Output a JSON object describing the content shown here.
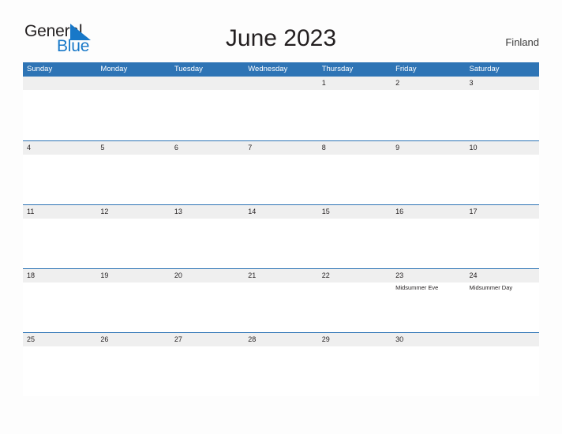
{
  "brand": {
    "name_part1": "General",
    "name_part2": "Blue",
    "flag_icon": "blue-triangle-flag-icon",
    "color_primary": "#1878c8",
    "color_text": "#231f20"
  },
  "header": {
    "title": "June 2023",
    "country": "Finland"
  },
  "calendar": {
    "accent_color": "#2e74b5",
    "band_color": "#efefef",
    "weekdays": [
      "Sunday",
      "Monday",
      "Tuesday",
      "Wednesday",
      "Thursday",
      "Friday",
      "Saturday"
    ],
    "weeks": [
      [
        {
          "day": "",
          "events": []
        },
        {
          "day": "",
          "events": []
        },
        {
          "day": "",
          "events": []
        },
        {
          "day": "",
          "events": []
        },
        {
          "day": "1",
          "events": []
        },
        {
          "day": "2",
          "events": []
        },
        {
          "day": "3",
          "events": []
        }
      ],
      [
        {
          "day": "4",
          "events": []
        },
        {
          "day": "5",
          "events": []
        },
        {
          "day": "6",
          "events": []
        },
        {
          "day": "7",
          "events": []
        },
        {
          "day": "8",
          "events": []
        },
        {
          "day": "9",
          "events": []
        },
        {
          "day": "10",
          "events": []
        }
      ],
      [
        {
          "day": "11",
          "events": []
        },
        {
          "day": "12",
          "events": []
        },
        {
          "day": "13",
          "events": []
        },
        {
          "day": "14",
          "events": []
        },
        {
          "day": "15",
          "events": []
        },
        {
          "day": "16",
          "events": []
        },
        {
          "day": "17",
          "events": []
        }
      ],
      [
        {
          "day": "18",
          "events": []
        },
        {
          "day": "19",
          "events": []
        },
        {
          "day": "20",
          "events": []
        },
        {
          "day": "21",
          "events": []
        },
        {
          "day": "22",
          "events": []
        },
        {
          "day": "23",
          "events": [
            "Midsummer Eve"
          ]
        },
        {
          "day": "24",
          "events": [
            "Midsummer Day"
          ]
        }
      ],
      [
        {
          "day": "25",
          "events": []
        },
        {
          "day": "26",
          "events": []
        },
        {
          "day": "27",
          "events": []
        },
        {
          "day": "28",
          "events": []
        },
        {
          "day": "29",
          "events": []
        },
        {
          "day": "30",
          "events": []
        },
        {
          "day": "",
          "events": []
        }
      ]
    ]
  }
}
